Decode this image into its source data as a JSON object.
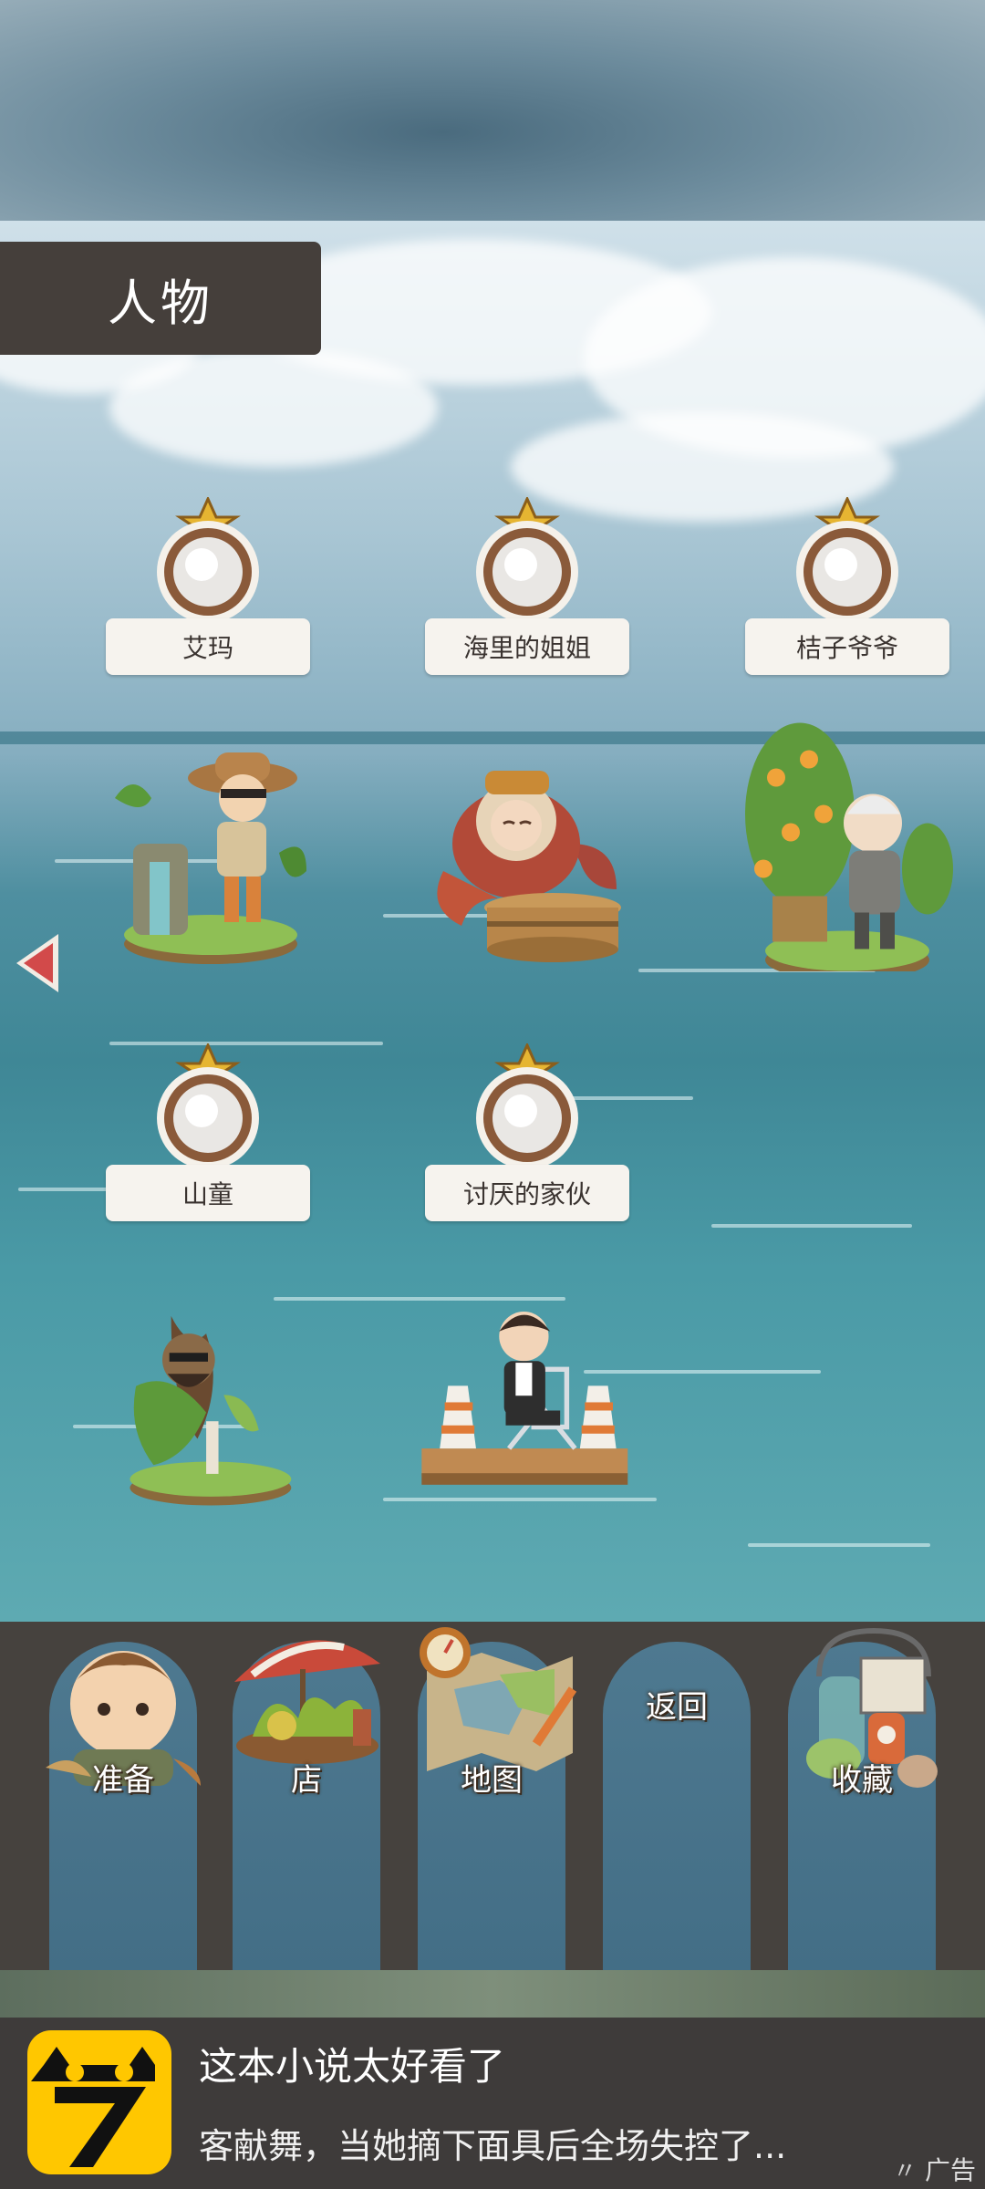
{
  "header": {
    "title": "人物"
  },
  "characters": [
    {
      "name": "艾玛",
      "icon": "explorer-with-hat-icon"
    },
    {
      "name": "海里的姐姐",
      "icon": "octopus-diver-icon"
    },
    {
      "name": "桔子爷爷",
      "icon": "orange-tree-grandpa-icon"
    },
    {
      "name": "山童",
      "icon": "mountain-child-icon"
    },
    {
      "name": "讨厌的家伙",
      "icon": "man-on-chair-icon"
    }
  ],
  "menu": {
    "prepare": "准备",
    "shop": "店",
    "map": "地图",
    "back": "返回",
    "collection": "收藏"
  },
  "ad": {
    "title": "这本小说太好看了",
    "description": "客献舞，当她摘下面具后全场失控了...",
    "tag": "广告"
  },
  "colors": {
    "title_panel": "#453f3b",
    "menu_bar": "#46423e",
    "menu_tab": "#4e7990",
    "ad_logo": "#ffc700"
  }
}
